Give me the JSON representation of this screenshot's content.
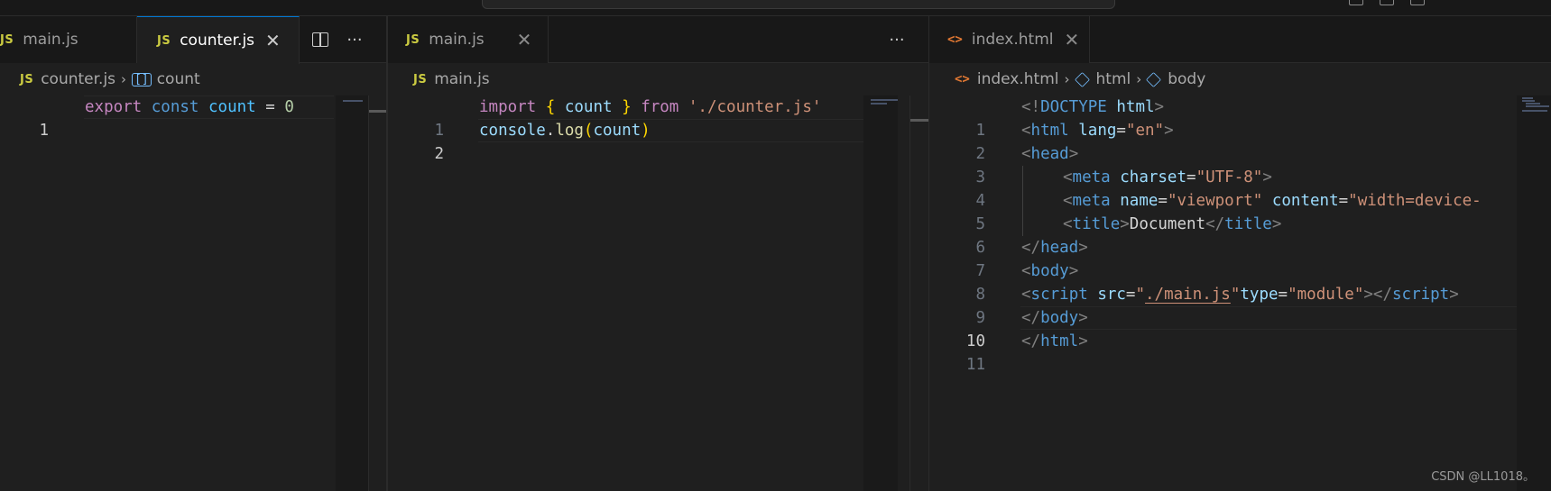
{
  "groups": [
    {
      "tabs": [
        {
          "label": "main.js",
          "icon": "js-icon",
          "active": false
        },
        {
          "label": "counter.js",
          "icon": "js-icon",
          "active": true,
          "close": "✕"
        }
      ],
      "actions": {
        "split": "split-editor-icon",
        "more": "···"
      },
      "breadcrumb": {
        "file": "counter.js",
        "symbol": "count"
      },
      "lines": [
        {
          "number": "1"
        }
      ]
    },
    {
      "tabs": [
        {
          "label": "main.js",
          "icon": "js-icon",
          "active": false,
          "close": "✕"
        }
      ],
      "actions": {
        "more": "···"
      },
      "breadcrumb": {
        "file": "main.js"
      },
      "lines": [
        {
          "number": "1"
        },
        {
          "number": "2"
        }
      ]
    },
    {
      "tabs": [
        {
          "label": "index.html",
          "icon": "html-icon",
          "active": false,
          "close": "✕"
        }
      ],
      "breadcrumb": {
        "file": "index.html",
        "html": "html",
        "body": "body"
      },
      "lines": [
        {
          "number": "1"
        },
        {
          "number": "2"
        },
        {
          "number": "3"
        },
        {
          "number": "4"
        },
        {
          "number": "5"
        },
        {
          "number": "6"
        },
        {
          "number": "7"
        },
        {
          "number": "8"
        },
        {
          "number": "9"
        },
        {
          "number": "10"
        },
        {
          "number": "11"
        }
      ]
    }
  ],
  "code": {
    "counter": {
      "export": "export",
      "const": "const",
      "count": "count",
      "eq": "=",
      "zero": "0"
    },
    "main": {
      "import": "import",
      "lbrace": "{",
      "count": "count",
      "rbrace": "}",
      "from": "from",
      "path": "'./counter.js'",
      "console": "console",
      "dot": ".",
      "log": "log",
      "lparen": "(",
      "arg": "count",
      "rparen": ")"
    },
    "html": {
      "l1_open": "<!",
      "l1_doctype": "DOCTYPE",
      "l1_html": "html",
      "l1_close": ">",
      "l2_open": "<",
      "l2_tag": "html",
      "l2_attr": "lang",
      "l2_eq": "=",
      "l2_val": "\"en\"",
      "l2_close": ">",
      "l3_open": "<",
      "l3_tag": "head",
      "l3_close": ">",
      "l4_open": "<",
      "l4_tag": "meta",
      "l4_attr": "charset",
      "l4_eq": "=",
      "l4_val": "\"UTF-8\"",
      "l4_close": ">",
      "l5_open": "<",
      "l5_tag": "meta",
      "l5_attr1": "name",
      "l5_eq1": "=",
      "l5_val1": "\"viewport\"",
      "l5_attr2": "content",
      "l5_eq2": "=",
      "l5_val2": "\"width=device-",
      "l6_open": "<",
      "l6_tag": "title",
      "l6_close": ">",
      "l6_text": "Document",
      "l6_endopen": "</",
      "l6_endtag": "title",
      "l6_endclose": ">",
      "l7_open": "</",
      "l7_tag": "head",
      "l7_close": ">",
      "l8_open": "<",
      "l8_tag": "body",
      "l8_close": ">",
      "l9_open": "<",
      "l9_tag": "script",
      "l9_attr1": "src",
      "l9_eq1": "=",
      "l9_q1": "\"",
      "l9_path": "./main.js",
      "l9_q2": "\"",
      "l9_attr2": "type",
      "l9_eq2": "=",
      "l9_val2": "\"module\"",
      "l9_close": "></",
      "l9_endtag": "script",
      "l9_endclose": ">",
      "l10_open": "</",
      "l10_tag": "body",
      "l10_close": ">",
      "l11_open": "</",
      "l11_tag": "html",
      "l11_close": ">"
    }
  },
  "watermark": "CSDN @LL1018。",
  "colors": {
    "editor_bg": "#1f1f1f",
    "tabbar_bg": "#181818",
    "active_tab_border": "#0078d4",
    "keyword_control": "#c586c0",
    "keyword": "#569cd6",
    "constant": "#4fc1ff",
    "variable": "#9cdcfe",
    "string": "#ce9178",
    "function": "#dcdcaa",
    "number": "#b5cea8",
    "js_icon": "#cbcb41",
    "html_icon": "#e37933"
  }
}
